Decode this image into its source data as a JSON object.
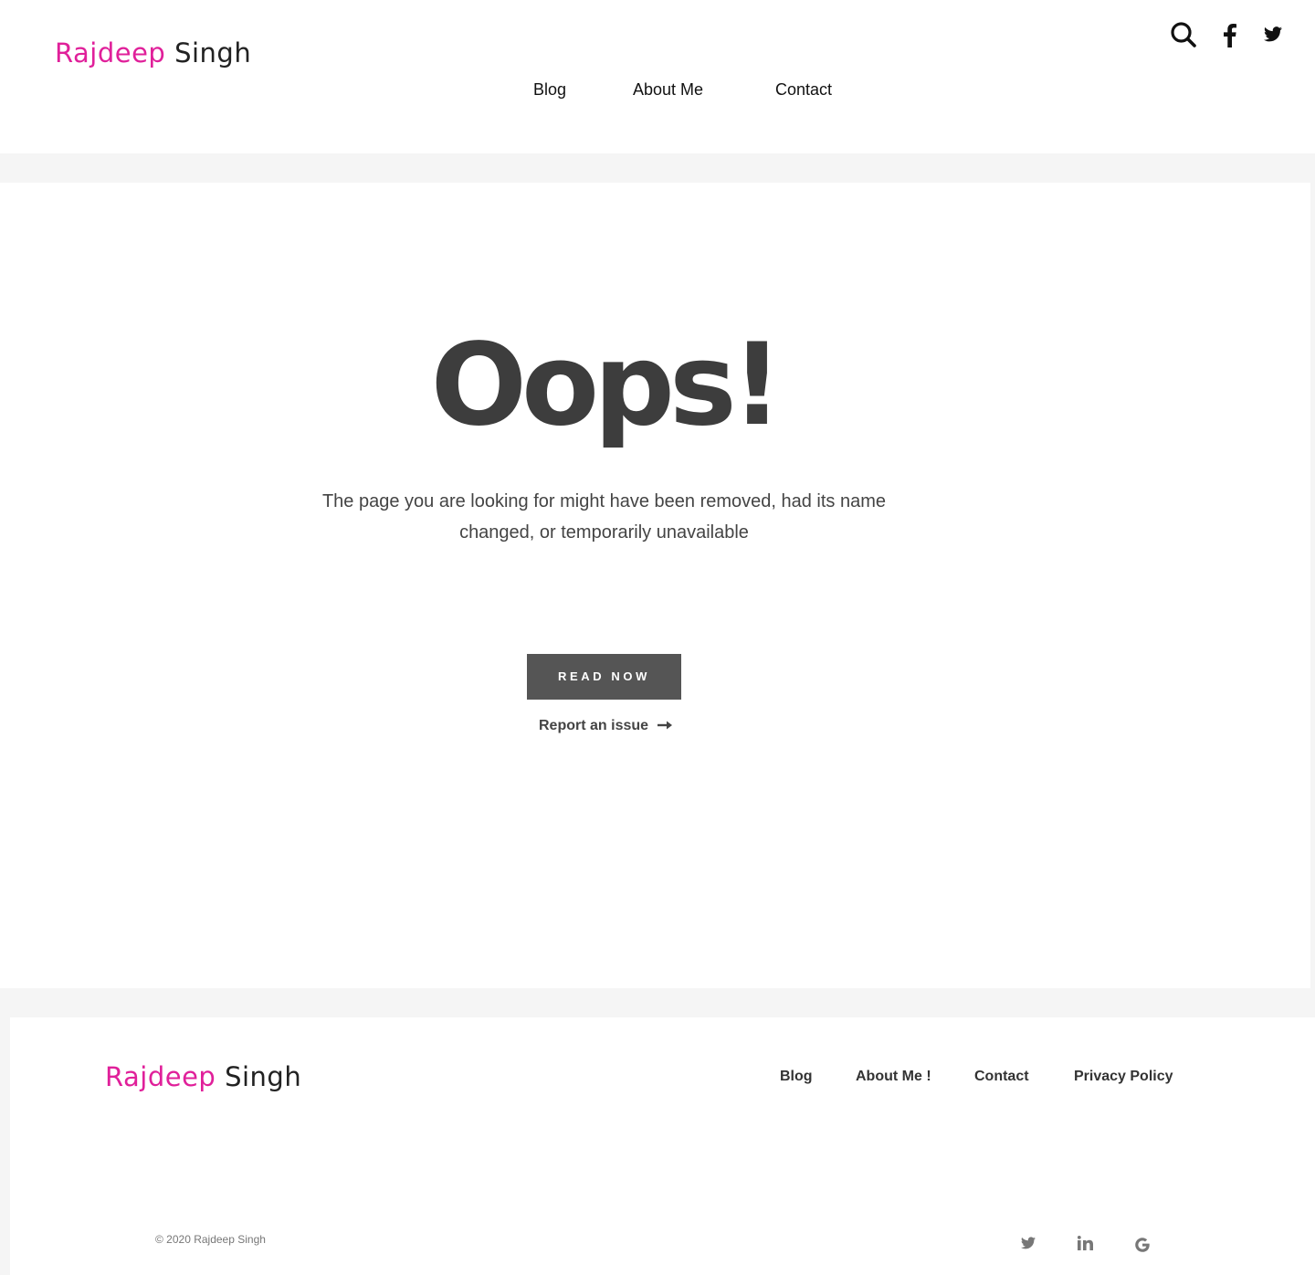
{
  "header": {
    "logo": {
      "first": "Rajdeep",
      "last": "Singh"
    },
    "nav": [
      {
        "label": "Blog"
      },
      {
        "label": "About Me"
      },
      {
        "label": "Contact"
      }
    ],
    "icons": [
      "search-icon",
      "facebook-icon",
      "twitter-icon"
    ]
  },
  "main": {
    "title": "Oops!",
    "message": "The page you are looking for might have been removed, had its name changed, or temporarily unavailable",
    "button_label": "READ NOW",
    "report_label": "Report an issue"
  },
  "footer": {
    "logo": {
      "first": "Rajdeep",
      "last": "Singh"
    },
    "nav": [
      {
        "label": "Blog"
      },
      {
        "label": "About Me !"
      },
      {
        "label": "Contact"
      },
      {
        "label": "Privacy Policy"
      }
    ],
    "copyright": "© 2020 Rajdeep Singh",
    "social_icons": [
      "twitter-icon",
      "linkedin-icon",
      "google-icon"
    ]
  },
  "colors": {
    "brand_pink": "#e0209a",
    "button_bg": "#555555",
    "page_bg": "#f5f5f5"
  }
}
